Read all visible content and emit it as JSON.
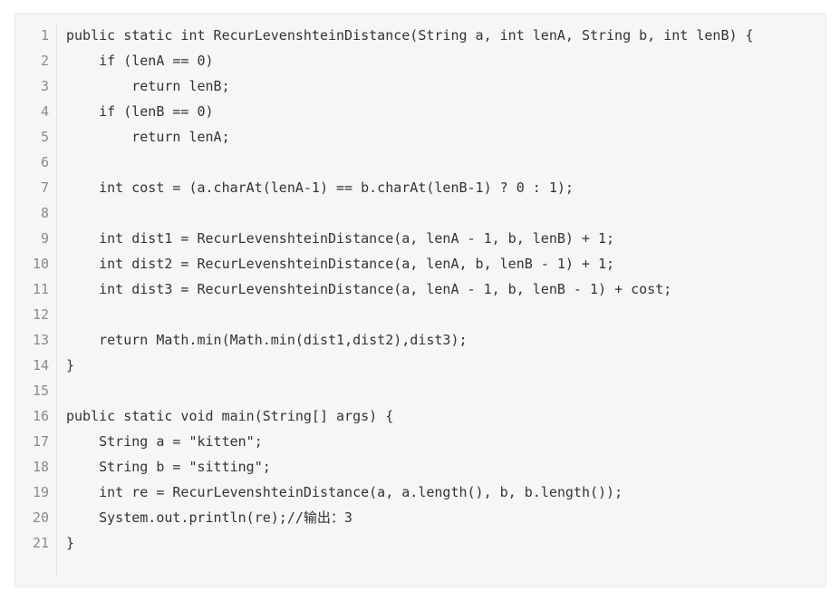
{
  "code_block": {
    "lines": [
      {
        "n": "1",
        "text": "public static int RecurLevenshteinDistance(String a, int lenA, String b, int lenB) {"
      },
      {
        "n": "2",
        "text": "    if (lenA == 0)"
      },
      {
        "n": "3",
        "text": "        return lenB;"
      },
      {
        "n": "4",
        "text": "    if (lenB == 0)"
      },
      {
        "n": "5",
        "text": "        return lenA;"
      },
      {
        "n": "6",
        "text": ""
      },
      {
        "n": "7",
        "text": "    int cost = (a.charAt(lenA-1) == b.charAt(lenB-1) ? 0 : 1);"
      },
      {
        "n": "8",
        "text": ""
      },
      {
        "n": "9",
        "text": "    int dist1 = RecurLevenshteinDistance(a, lenA - 1, b, lenB) + 1;"
      },
      {
        "n": "10",
        "text": "    int dist2 = RecurLevenshteinDistance(a, lenA, b, lenB - 1) + 1;"
      },
      {
        "n": "11",
        "text": "    int dist3 = RecurLevenshteinDistance(a, lenA - 1, b, lenB - 1) + cost;"
      },
      {
        "n": "12",
        "text": ""
      },
      {
        "n": "13",
        "text": "    return Math.min(Math.min(dist1,dist2),dist3);"
      },
      {
        "n": "14",
        "text": "}"
      },
      {
        "n": "15",
        "text": ""
      },
      {
        "n": "16",
        "text": "public static void main(String[] args) {"
      },
      {
        "n": "17",
        "text": "    String a = \"kitten\";"
      },
      {
        "n": "18",
        "text": "    String b = \"sitting\";"
      },
      {
        "n": "19",
        "text": "    int re = RecurLevenshteinDistance(a, a.length(), b, b.length());"
      },
      {
        "n": "20",
        "text": "    System.out.println(re);//输出：3"
      },
      {
        "n": "21",
        "text": "}"
      }
    ]
  }
}
